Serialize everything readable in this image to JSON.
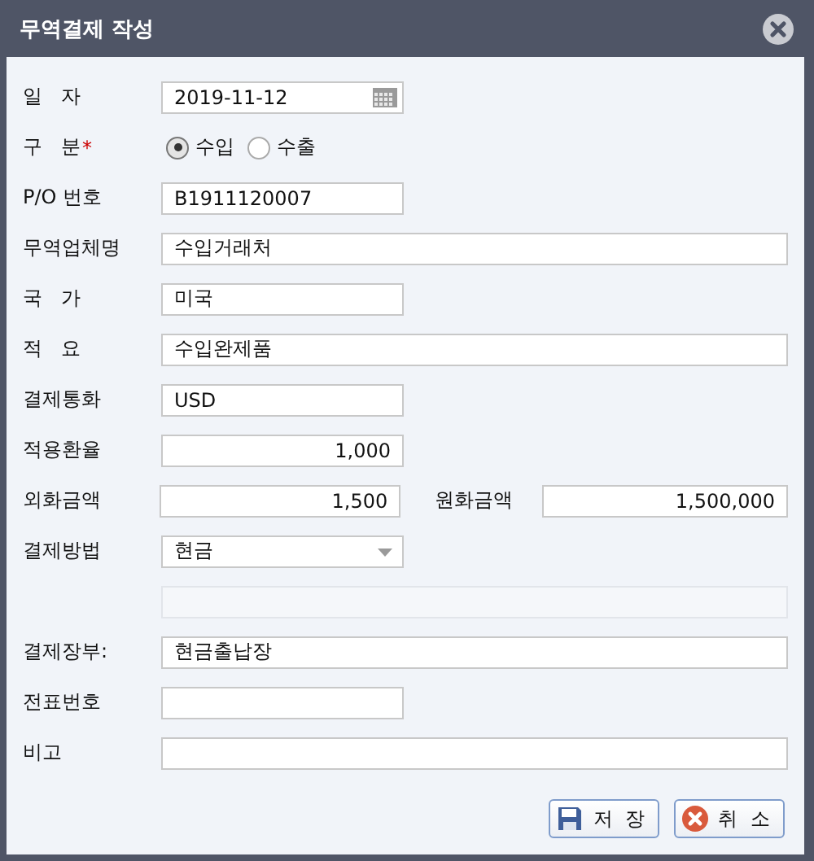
{
  "window": {
    "title": "무역결제 작성"
  },
  "fields": [
    {
      "kind": "date",
      "label": "일   자",
      "value": "2019-11-12"
    },
    {
      "kind": "radio",
      "label": "구   분",
      "required_mark": "*",
      "options": [
        {
          "label": "수입",
          "selected": true
        },
        {
          "label": "수출",
          "selected": false
        }
      ]
    },
    {
      "kind": "short",
      "label": "P/O 번호",
      "value": "B1911120007"
    },
    {
      "kind": "long",
      "label": "무역업체명",
      "value": "수입거래처"
    },
    {
      "kind": "short",
      "label": "국   가",
      "value": "미국"
    },
    {
      "kind": "long",
      "label": "적   요",
      "value": "수입완제품"
    },
    {
      "kind": "short",
      "label": "결제통화",
      "value": "USD"
    },
    {
      "kind": "number",
      "label": "적용환율",
      "value": "1,000"
    },
    {
      "kind": "pair",
      "label": "외화금액",
      "value": "1,500",
      "second_label": "원화금액",
      "second_value": "1,500,000"
    },
    {
      "kind": "select",
      "label": "결제방법",
      "value": "현금"
    },
    {
      "kind": "blank"
    },
    {
      "kind": "long",
      "label": "결제장부:",
      "value": "현금출납장"
    },
    {
      "kind": "short",
      "label": "전표번호"
    },
    {
      "kind": "long",
      "label": "비고"
    }
  ],
  "buttons": [
    {
      "kind": "save",
      "label": "저 장"
    },
    {
      "kind": "cancel",
      "label": "취 소"
    }
  ]
}
